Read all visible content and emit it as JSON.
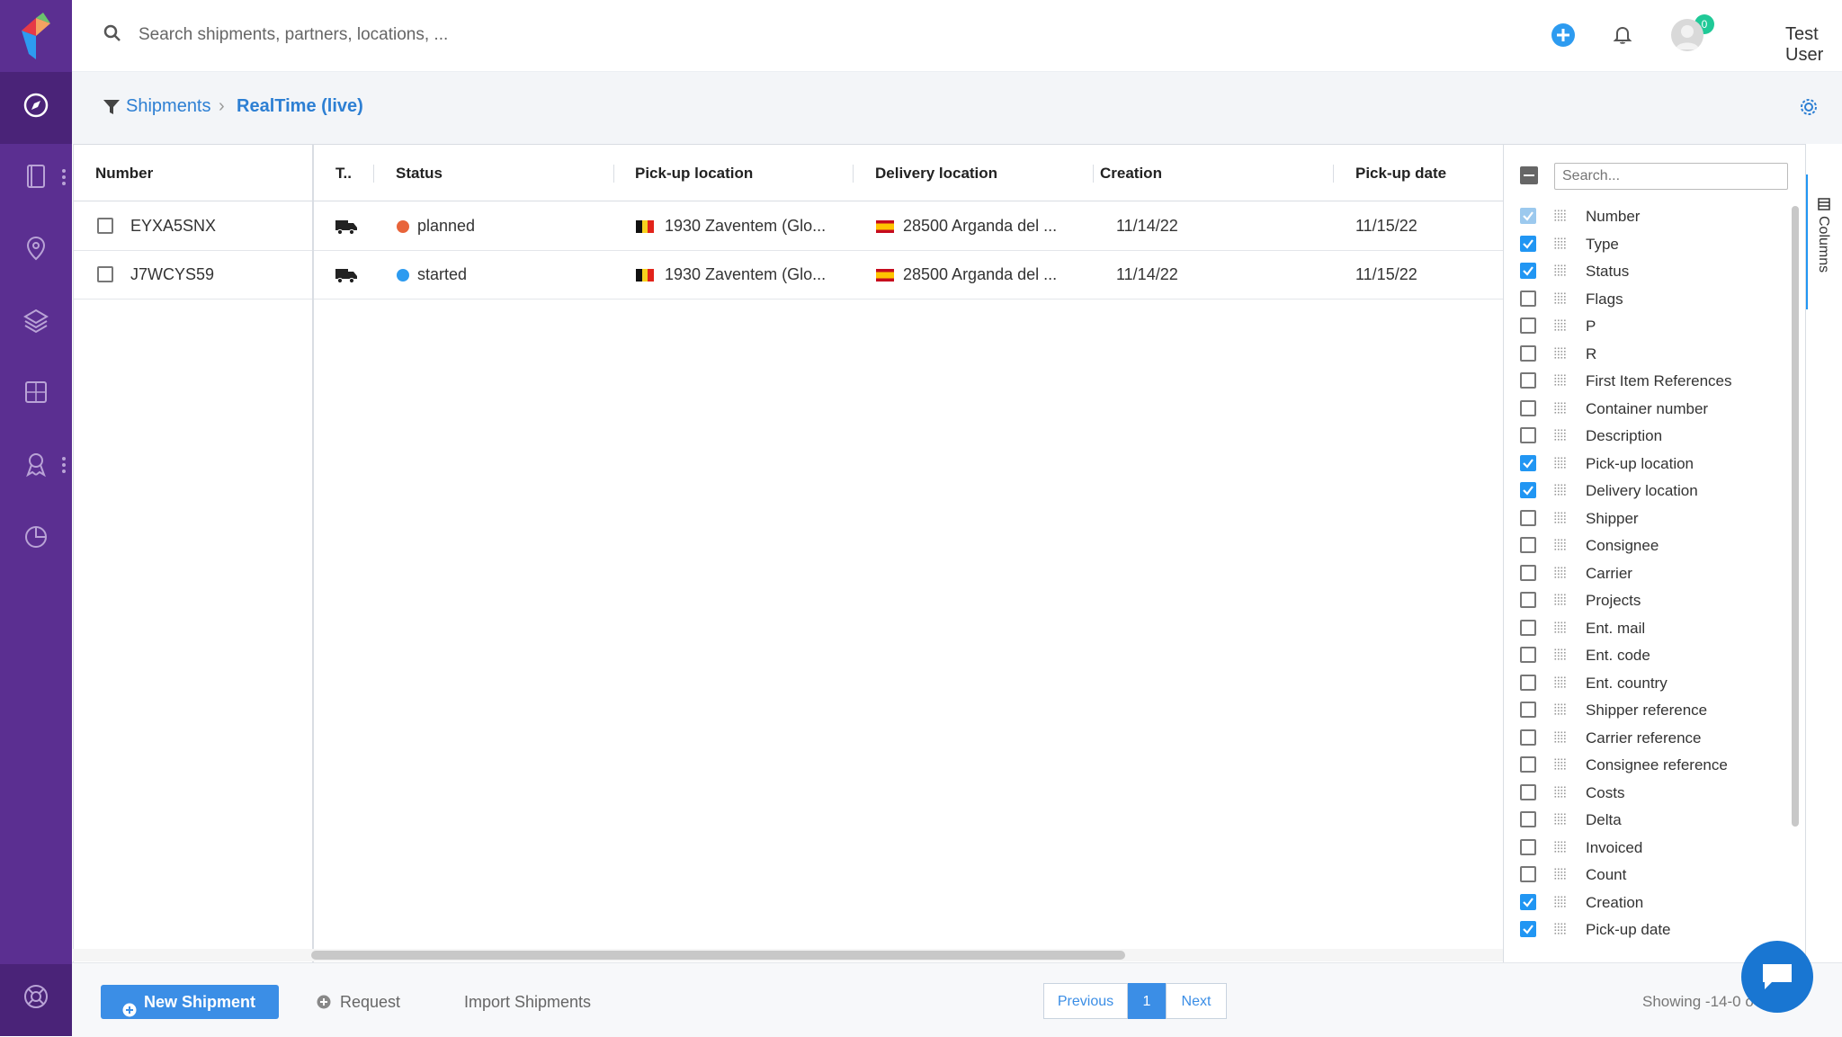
{
  "search": {
    "placeholder": "Search shipments, partners, locations, ..."
  },
  "header": {
    "notification_count": "0",
    "user_name": "Test User"
  },
  "breadcrumb": {
    "root": "Shipments",
    "separator": "›",
    "current": "RealTime (live)"
  },
  "grid": {
    "columns": [
      "Number",
      "T..",
      "Status",
      "Pick-up location",
      "Delivery location",
      "Creation",
      "Pick-up date"
    ],
    "rows": [
      {
        "number": "EYXA5SNX",
        "status": "planned",
        "status_color": "#e8643a",
        "pickup": "1930 Zaventem (Glo...",
        "pickup_country": "Belgium",
        "delivery": "28500 Arganda del ...",
        "delivery_country": "Spain",
        "creation": "11/14/22",
        "pickup_date": "11/15/22"
      },
      {
        "number": "J7WCYS59",
        "status": "started",
        "status_color": "#2d9bf0",
        "pickup": "1930 Zaventem (Glo...",
        "pickup_country": "Belgium",
        "delivery": "28500 Arganda del ...",
        "delivery_country": "Spain",
        "creation": "11/14/22",
        "pickup_date": "11/15/22"
      }
    ]
  },
  "column_panel": {
    "search_placeholder": "Search...",
    "tab_label": "Columns",
    "items": [
      {
        "label": "Number",
        "checked": "locked"
      },
      {
        "label": "Type",
        "checked": true
      },
      {
        "label": "Status",
        "checked": true
      },
      {
        "label": "Flags",
        "checked": false
      },
      {
        "label": "P",
        "checked": false
      },
      {
        "label": "R",
        "checked": false
      },
      {
        "label": "First Item References",
        "checked": false
      },
      {
        "label": "Container number",
        "checked": false
      },
      {
        "label": "Description",
        "checked": false
      },
      {
        "label": "Pick-up location",
        "checked": true
      },
      {
        "label": "Delivery location",
        "checked": true
      },
      {
        "label": "Shipper",
        "checked": false
      },
      {
        "label": "Consignee",
        "checked": false
      },
      {
        "label": "Carrier",
        "checked": false
      },
      {
        "label": "Projects",
        "checked": false
      },
      {
        "label": "Ent. mail",
        "checked": false
      },
      {
        "label": "Ent. code",
        "checked": false
      },
      {
        "label": "Ent. country",
        "checked": false
      },
      {
        "label": "Shipper reference",
        "checked": false
      },
      {
        "label": "Carrier reference",
        "checked": false
      },
      {
        "label": "Consignee reference",
        "checked": false
      },
      {
        "label": "Costs",
        "checked": false
      },
      {
        "label": "Delta",
        "checked": false
      },
      {
        "label": "Invoiced",
        "checked": false
      },
      {
        "label": "Count",
        "checked": false
      },
      {
        "label": "Creation",
        "checked": true
      },
      {
        "label": "Pick-up date",
        "checked": true
      }
    ]
  },
  "footer": {
    "new_shipment": "New Shipment",
    "request": "Request",
    "import": "Import Shipments",
    "previous": "Previous",
    "page": "1",
    "next": "Next",
    "showing": "Showing -14-0 o"
  },
  "colors": {
    "sidebar": "#5b2f91",
    "accent": "#2d7fd3",
    "primary_button": "#3b8ee6",
    "check": "#2196f3"
  }
}
